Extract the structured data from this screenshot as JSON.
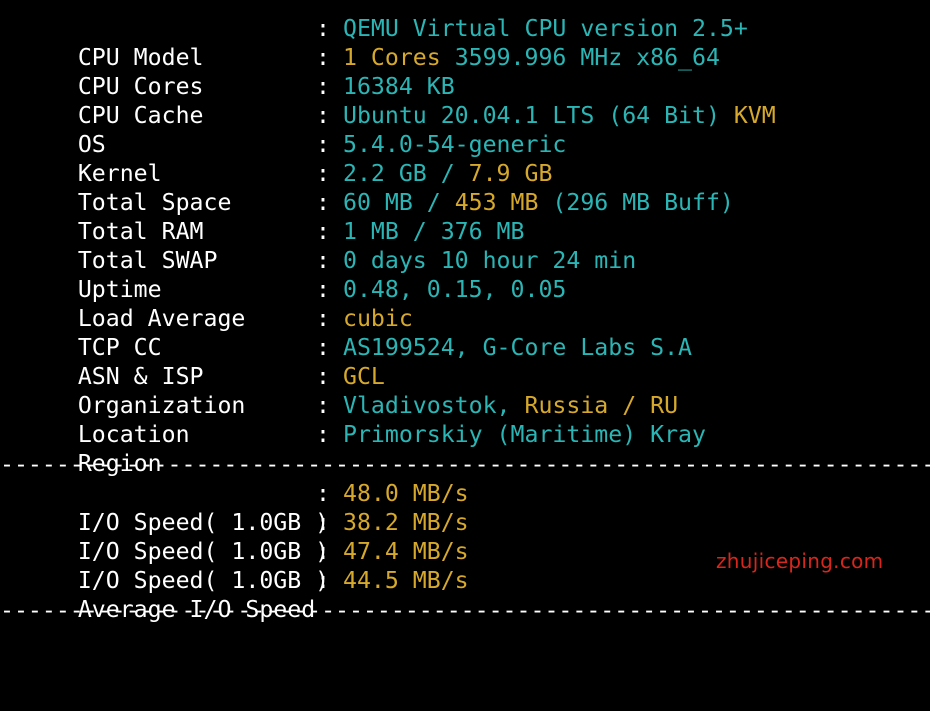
{
  "colors": {
    "background": "#000000",
    "label": "#ffffff",
    "cyan": "#2bb5b5",
    "yellow": "#d6a92c",
    "watermark": "#d8261c"
  },
  "separator": ":",
  "divider": "--------------------------------------------------------------------",
  "info": [
    {
      "label": "CPU Model",
      "parts": [
        {
          "text": "QEMU Virtual CPU version 2.5+",
          "color": "cyan"
        }
      ]
    },
    {
      "label": "CPU Cores",
      "parts": [
        {
          "text": "1 Cores ",
          "color": "yellow"
        },
        {
          "text": "3599.996 MHz x86_64",
          "color": "cyan"
        }
      ]
    },
    {
      "label": "CPU Cache",
      "parts": [
        {
          "text": "16384 KB",
          "color": "cyan"
        }
      ]
    },
    {
      "label": "OS",
      "parts": [
        {
          "text": "Ubuntu 20.04.1 LTS (64 Bit) ",
          "color": "cyan"
        },
        {
          "text": "KVM",
          "color": "yellow"
        }
      ]
    },
    {
      "label": "Kernel",
      "parts": [
        {
          "text": "5.4.0-54-generic",
          "color": "cyan"
        }
      ]
    },
    {
      "label": "Total Space",
      "parts": [
        {
          "text": "2.2 GB / ",
          "color": "cyan"
        },
        {
          "text": "7.9 GB",
          "color": "yellow"
        }
      ]
    },
    {
      "label": "Total RAM",
      "parts": [
        {
          "text": "60 MB / ",
          "color": "cyan"
        },
        {
          "text": "453 MB",
          "color": "yellow"
        },
        {
          "text": " (296 MB Buff)",
          "color": "cyan"
        }
      ]
    },
    {
      "label": "Total SWAP",
      "parts": [
        {
          "text": "1 MB / 376 MB",
          "color": "cyan"
        }
      ]
    },
    {
      "label": "Uptime",
      "parts": [
        {
          "text": "0 days 10 hour 24 min",
          "color": "cyan"
        }
      ]
    },
    {
      "label": "Load Average",
      "parts": [
        {
          "text": "0.48, 0.15, 0.05",
          "color": "cyan"
        }
      ]
    },
    {
      "label": "TCP CC",
      "parts": [
        {
          "text": "cubic",
          "color": "yellow"
        }
      ]
    },
    {
      "label": "ASN & ISP",
      "parts": [
        {
          "text": "AS199524, G-Core Labs S.A",
          "color": "cyan"
        }
      ]
    },
    {
      "label": "Organization",
      "parts": [
        {
          "text": "GCL",
          "color": "yellow"
        }
      ]
    },
    {
      "label": "Location",
      "parts": [
        {
          "text": "Vladivostok, ",
          "color": "cyan"
        },
        {
          "text": "Russia / RU",
          "color": "yellow"
        }
      ]
    },
    {
      "label": "Region",
      "parts": [
        {
          "text": "Primorskiy (Maritime) Kray",
          "color": "cyan"
        }
      ]
    }
  ],
  "io": [
    {
      "label": "I/O Speed( 1.0GB )",
      "value": "48.0 MB/s"
    },
    {
      "label": "I/O Speed( 1.0GB )",
      "value": "38.2 MB/s"
    },
    {
      "label": "I/O Speed( 1.0GB )",
      "value": "47.4 MB/s"
    },
    {
      "label": "Average I/O Speed",
      "value": "44.5 MB/s"
    }
  ],
  "watermark": "zhujiceping.com"
}
